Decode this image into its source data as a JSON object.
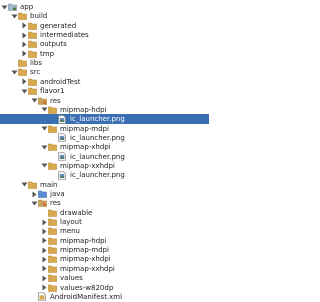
{
  "tree": {
    "items": [
      {
        "label": "app",
        "depth": 0,
        "icon": "module-folder-icon",
        "state": "expanded"
      },
      {
        "label": "build",
        "depth": 1,
        "icon": "folder-icon",
        "state": "expanded"
      },
      {
        "label": "generated",
        "depth": 2,
        "icon": "folder-icon",
        "state": "collapsed"
      },
      {
        "label": "intermediates",
        "depth": 2,
        "icon": "folder-icon",
        "state": "collapsed"
      },
      {
        "label": "outputs",
        "depth": 2,
        "icon": "folder-icon",
        "state": "collapsed"
      },
      {
        "label": "tmp",
        "depth": 2,
        "icon": "folder-icon",
        "state": "collapsed"
      },
      {
        "label": "libs",
        "depth": 1,
        "icon": "folder-icon",
        "state": "leaf"
      },
      {
        "label": "src",
        "depth": 1,
        "icon": "folder-icon",
        "state": "expanded"
      },
      {
        "label": "androidTest",
        "depth": 2,
        "icon": "folder-icon",
        "state": "collapsed"
      },
      {
        "label": "flavor1",
        "depth": 2,
        "icon": "folder-icon",
        "state": "expanded"
      },
      {
        "label": "res",
        "depth": 3,
        "icon": "res-folder-icon",
        "state": "expanded"
      },
      {
        "label": "mipmap-hdpi",
        "depth": 4,
        "icon": "folder-icon",
        "state": "expanded"
      },
      {
        "label": "ic_launcher.png",
        "depth": 5,
        "icon": "image-file-icon",
        "state": "leaf",
        "selected": true
      },
      {
        "label": "mipmap-mdpi",
        "depth": 4,
        "icon": "folder-icon",
        "state": "expanded"
      },
      {
        "label": "ic_launcher.png",
        "depth": 5,
        "icon": "image-file-icon",
        "state": "leaf"
      },
      {
        "label": "mipmap-xhdpi",
        "depth": 4,
        "icon": "folder-icon",
        "state": "expanded"
      },
      {
        "label": "ic_launcher.png",
        "depth": 5,
        "icon": "image-file-icon",
        "state": "leaf"
      },
      {
        "label": "mipmap-xxhdpi",
        "depth": 4,
        "icon": "folder-icon",
        "state": "expanded"
      },
      {
        "label": "ic_launcher.png",
        "depth": 5,
        "icon": "image-file-icon",
        "state": "leaf"
      },
      {
        "label": "main",
        "depth": 2,
        "icon": "folder-icon",
        "state": "expanded"
      },
      {
        "label": "java",
        "depth": 3,
        "icon": "source-folder-icon",
        "state": "collapsed"
      },
      {
        "label": "res",
        "depth": 3,
        "icon": "res-folder-icon",
        "state": "expanded"
      },
      {
        "label": "drawable",
        "depth": 4,
        "icon": "folder-icon",
        "state": "leaf"
      },
      {
        "label": "layout",
        "depth": 4,
        "icon": "folder-icon",
        "state": "collapsed"
      },
      {
        "label": "menu",
        "depth": 4,
        "icon": "folder-icon",
        "state": "collapsed"
      },
      {
        "label": "mipmap-hdpi",
        "depth": 4,
        "icon": "folder-icon",
        "state": "collapsed"
      },
      {
        "label": "mipmap-mdpi",
        "depth": 4,
        "icon": "folder-icon",
        "state": "collapsed"
      },
      {
        "label": "mipmap-xhdpi",
        "depth": 4,
        "icon": "folder-icon",
        "state": "collapsed"
      },
      {
        "label": "mipmap-xxhdpi",
        "depth": 4,
        "icon": "folder-icon",
        "state": "collapsed"
      },
      {
        "label": "values",
        "depth": 4,
        "icon": "folder-icon",
        "state": "collapsed"
      },
      {
        "label": "values-w820dp",
        "depth": 4,
        "icon": "folder-icon",
        "state": "collapsed"
      },
      {
        "label": "AndroidManifest.xml",
        "depth": 3,
        "icon": "manifest-file-icon",
        "state": "leaf"
      }
    ]
  },
  "colors": {
    "folder": "#d9a94f",
    "folder_dark": "#b8862e",
    "module_folder": "#a7b8cc",
    "res_folder": "#c6a15b",
    "source_folder": "#5b8fd4",
    "selection": "#3a6fb3",
    "arrow": "#555555"
  }
}
